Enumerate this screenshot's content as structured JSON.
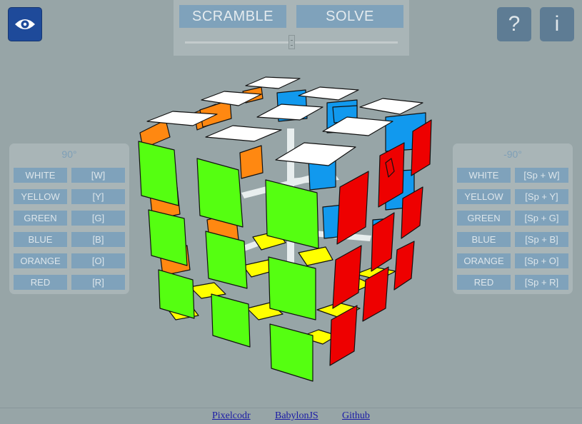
{
  "toolbar": {
    "scramble_label": "SCRAMBLE",
    "solve_label": "SOLVE",
    "speed_slider_value": 0.5
  },
  "corner": {
    "help_label": "?",
    "info_label": "i",
    "view_icon": "eye-icon"
  },
  "left_panel": {
    "title": "90°",
    "rows": [
      {
        "color": "WHITE",
        "key": "[W]"
      },
      {
        "color": "YELLOW",
        "key": "[Y]"
      },
      {
        "color": "GREEN",
        "key": "[G]"
      },
      {
        "color": "BLUE",
        "key": "[B]"
      },
      {
        "color": "ORANGE",
        "key": "[O]"
      },
      {
        "color": "RED",
        "key": "[R]"
      }
    ]
  },
  "right_panel": {
    "title": "-90°",
    "rows": [
      {
        "color": "WHITE",
        "key": "[Sp + W]"
      },
      {
        "color": "YELLOW",
        "key": "[Sp + Y]"
      },
      {
        "color": "GREEN",
        "key": "[Sp + G]"
      },
      {
        "color": "BLUE",
        "key": "[Sp + B]"
      },
      {
        "color": "ORANGE",
        "key": "[Sp + O]"
      },
      {
        "color": "RED",
        "key": "[Sp + R]"
      }
    ]
  },
  "footer": {
    "links": [
      "Pixelcodr",
      "BabylonJS",
      "Github"
    ]
  },
  "cube_colors": {
    "white": "#ffffff",
    "yellow": "#ffff00",
    "green": "#55ff11",
    "blue": "#1199ee",
    "orange": "#ff8811",
    "red": "#ee0000"
  }
}
